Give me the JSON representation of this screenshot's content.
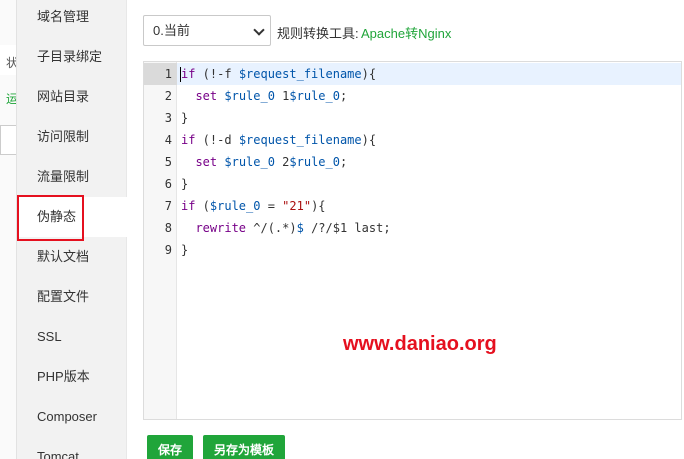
{
  "background_panel": {
    "fragments": [
      "状",
      "运"
    ]
  },
  "sidebar": {
    "items": [
      {
        "label": "域名管理"
      },
      {
        "label": "子目录绑定"
      },
      {
        "label": "网站目录"
      },
      {
        "label": "访问限制"
      },
      {
        "label": "流量限制"
      },
      {
        "label": "伪静态",
        "active": true
      },
      {
        "label": "默认文档"
      },
      {
        "label": "配置文件"
      },
      {
        "label": "SSL"
      },
      {
        "label": "PHP版本"
      },
      {
        "label": "Composer"
      },
      {
        "label": "Tomcat"
      }
    ]
  },
  "toolbar": {
    "select_value": "0.当前",
    "tool_label": "规则转换工具:",
    "tool_link": "Apache转Nginx"
  },
  "editor": {
    "line_numbers": [
      "1",
      "2",
      "3",
      "4",
      "5",
      "6",
      "7",
      "8",
      "9"
    ],
    "lines": [
      [
        {
          "t": "if",
          "c": "kw"
        },
        {
          "t": " (!-f ",
          "c": ""
        },
        {
          "t": "$request_filename",
          "c": "var"
        },
        {
          "t": "){",
          "c": ""
        }
      ],
      [
        {
          "t": "  ",
          "c": ""
        },
        {
          "t": "set",
          "c": "kw"
        },
        {
          "t": " ",
          "c": ""
        },
        {
          "t": "$rule_0",
          "c": "var"
        },
        {
          "t": " 1",
          "c": ""
        },
        {
          "t": "$rule_0",
          "c": "var"
        },
        {
          "t": ";",
          "c": ""
        }
      ],
      [
        {
          "t": "}",
          "c": ""
        }
      ],
      [
        {
          "t": "if",
          "c": "kw"
        },
        {
          "t": " (!-d ",
          "c": ""
        },
        {
          "t": "$request_filename",
          "c": "var"
        },
        {
          "t": "){",
          "c": ""
        }
      ],
      [
        {
          "t": "  ",
          "c": ""
        },
        {
          "t": "set",
          "c": "kw"
        },
        {
          "t": " ",
          "c": ""
        },
        {
          "t": "$rule_0",
          "c": "var"
        },
        {
          "t": " 2",
          "c": ""
        },
        {
          "t": "$rule_0",
          "c": "var"
        },
        {
          "t": ";",
          "c": ""
        }
      ],
      [
        {
          "t": "}",
          "c": ""
        }
      ],
      [
        {
          "t": "if",
          "c": "kw"
        },
        {
          "t": " (",
          "c": ""
        },
        {
          "t": "$rule_0",
          "c": "var"
        },
        {
          "t": " = ",
          "c": ""
        },
        {
          "t": "\"21\"",
          "c": "str"
        },
        {
          "t": "){",
          "c": ""
        }
      ],
      [
        {
          "t": "  ",
          "c": ""
        },
        {
          "t": "rewrite",
          "c": "kw"
        },
        {
          "t": " ^/(.*)",
          "c": ""
        },
        {
          "t": "$",
          "c": "var"
        },
        {
          "t": " /?/$1 last;",
          "c": ""
        }
      ],
      [
        {
          "t": "}",
          "c": ""
        }
      ]
    ],
    "watermark": "www.daniao.org"
  },
  "buttons": {
    "save": "保存",
    "save_as_template": "另存为模板"
  },
  "colors": {
    "accent": "#20a53a",
    "highlight_box": "#e5101f",
    "watermark": "#e5101f"
  }
}
